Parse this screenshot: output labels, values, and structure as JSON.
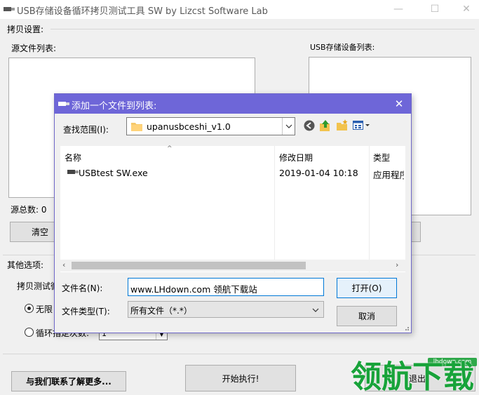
{
  "window": {
    "title": "USB存储设备循环拷贝测试工具 SW  by Lizcst Software Lab",
    "minimize": "—",
    "maximize": "☐",
    "close": "✕"
  },
  "copy_settings": {
    "group_label": "拷贝设置:",
    "source_list_label": "源文件列表:",
    "usb_list_label": "USB存储设备列表:",
    "source_count_label": "源总数: 0",
    "clear_button": "清空"
  },
  "other_options": {
    "group_label": "其他选项:",
    "test_label_partial": "拷贝测试循",
    "radio_unlimited": "无限",
    "radio_count_label": "循环指定次数:",
    "count_value": "1"
  },
  "bottom": {
    "contact_button": "与我们联系了解更多...",
    "start_button": "开始执行!",
    "exit_button": "退出"
  },
  "dialog": {
    "title": "添加一个文件到列表:",
    "look_in_label": "查找范围(I):",
    "look_in_value": "upanusbceshi_v1.0",
    "columns": [
      "名称",
      "修改日期",
      "类型"
    ],
    "files": [
      {
        "name": "USBtest SW.exe",
        "modified": "2019-01-04 10:18",
        "type": "应用程序"
      }
    ],
    "filename_label": "文件名(N):",
    "filename_value": "www.LHdown.com  领航下载站",
    "filetype_label": "文件类型(T):",
    "filetype_value": "所有文件（*.*）",
    "open_button": "打开(O)",
    "cancel_button": "取消"
  },
  "watermark": {
    "url": "lhdown.com",
    "brand": "领航下载"
  },
  "colors": {
    "dialog_titlebar": "#6e66d8",
    "watermark_green": "#18a33a",
    "button_face": "#e1e1e1"
  }
}
